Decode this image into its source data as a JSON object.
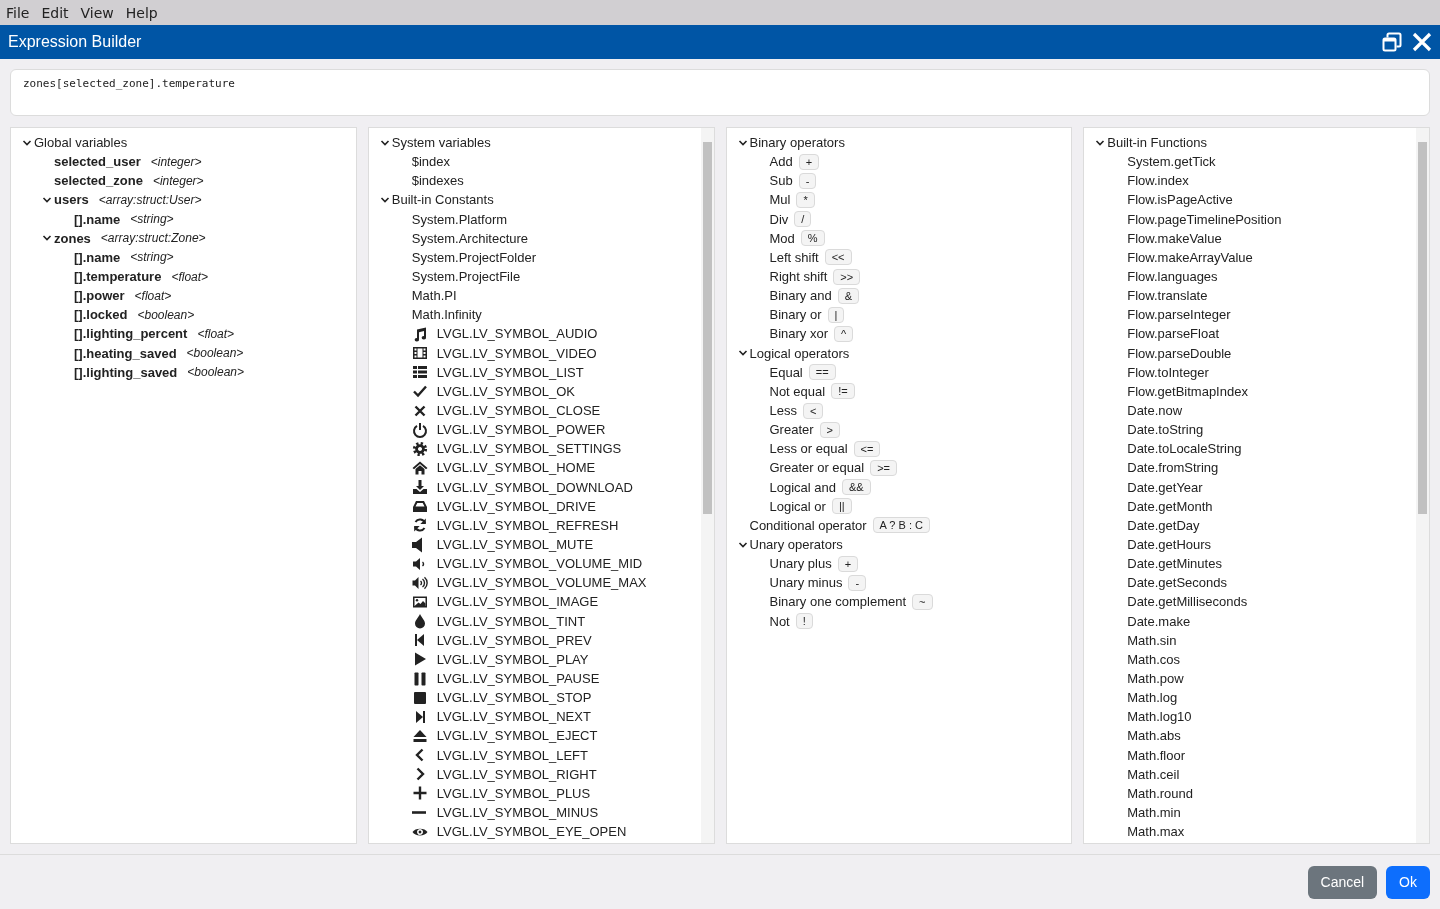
{
  "menu": [
    "File",
    "Edit",
    "View",
    "Help"
  ],
  "window": {
    "title": "Expression Builder"
  },
  "expression": {
    "value": "zones[selected_zone].temperature"
  },
  "panels": [
    {
      "kind": "variables",
      "scrollbar": false,
      "tree": [
        {
          "label": "Global variables",
          "expanded": true,
          "children": [
            {
              "label": "selected_user",
              "type": "<integer>"
            },
            {
              "label": "selected_zone",
              "type": "<integer>"
            },
            {
              "label": "users",
              "type": "<array:struct:User>",
              "expanded": true,
              "children": [
                {
                  "label": "[].name",
                  "type": "<string>"
                }
              ]
            },
            {
              "label": "zones",
              "type": "<array:struct:Zone>",
              "expanded": true,
              "children": [
                {
                  "label": "[].name",
                  "type": "<string>"
                },
                {
                  "label": "[].temperature",
                  "type": "<float>"
                },
                {
                  "label": "[].power",
                  "type": "<float>"
                },
                {
                  "label": "[].locked",
                  "type": "<boolean>"
                },
                {
                  "label": "[].lighting_percent",
                  "type": "<float>"
                },
                {
                  "label": "[].heating_saved",
                  "type": "<boolean>"
                },
                {
                  "label": "[].lighting_saved",
                  "type": "<boolean>"
                }
              ]
            }
          ]
        }
      ]
    },
    {
      "kind": "constants",
      "scrollbar": true,
      "tree": [
        {
          "label": "System variables",
          "expanded": true,
          "children": [
            {
              "label": "$index",
              "kind": "plain"
            },
            {
              "label": "$indexes",
              "kind": "plain"
            }
          ]
        },
        {
          "label": "Built-in Constants",
          "expanded": true,
          "children": [
            {
              "label": "System.Platform",
              "kind": "plain"
            },
            {
              "label": "System.Architecture",
              "kind": "plain"
            },
            {
              "label": "System.ProjectFolder",
              "kind": "plain"
            },
            {
              "label": "System.ProjectFile",
              "kind": "plain"
            },
            {
              "label": "Math.PI",
              "kind": "plain"
            },
            {
              "label": "Math.Infinity",
              "kind": "plain"
            },
            {
              "label": "LVGL.LV_SYMBOL_AUDIO",
              "kind": "audio"
            },
            {
              "label": "LVGL.LV_SYMBOL_VIDEO",
              "kind": "video"
            },
            {
              "label": "LVGL.LV_SYMBOL_LIST",
              "kind": "list"
            },
            {
              "label": "LVGL.LV_SYMBOL_OK",
              "kind": "ok"
            },
            {
              "label": "LVGL.LV_SYMBOL_CLOSE",
              "kind": "close"
            },
            {
              "label": "LVGL.LV_SYMBOL_POWER",
              "kind": "power"
            },
            {
              "label": "LVGL.LV_SYMBOL_SETTINGS",
              "kind": "settings"
            },
            {
              "label": "LVGL.LV_SYMBOL_HOME",
              "kind": "home"
            },
            {
              "label": "LVGL.LV_SYMBOL_DOWNLOAD",
              "kind": "download"
            },
            {
              "label": "LVGL.LV_SYMBOL_DRIVE",
              "kind": "drive"
            },
            {
              "label": "LVGL.LV_SYMBOL_REFRESH",
              "kind": "refresh"
            },
            {
              "label": "LVGL.LV_SYMBOL_MUTE",
              "kind": "mute"
            },
            {
              "label": "LVGL.LV_SYMBOL_VOLUME_MID",
              "kind": "volume_mid"
            },
            {
              "label": "LVGL.LV_SYMBOL_VOLUME_MAX",
              "kind": "volume_max"
            },
            {
              "label": "LVGL.LV_SYMBOL_IMAGE",
              "kind": "image"
            },
            {
              "label": "LVGL.LV_SYMBOL_TINT",
              "kind": "tint"
            },
            {
              "label": "LVGL.LV_SYMBOL_PREV",
              "kind": "prev"
            },
            {
              "label": "LVGL.LV_SYMBOL_PLAY",
              "kind": "play"
            },
            {
              "label": "LVGL.LV_SYMBOL_PAUSE",
              "kind": "pause"
            },
            {
              "label": "LVGL.LV_SYMBOL_STOP",
              "kind": "stop"
            },
            {
              "label": "LVGL.LV_SYMBOL_NEXT",
              "kind": "next"
            },
            {
              "label": "LVGL.LV_SYMBOL_EJECT",
              "kind": "eject"
            },
            {
              "label": "LVGL.LV_SYMBOL_LEFT",
              "kind": "left"
            },
            {
              "label": "LVGL.LV_SYMBOL_RIGHT",
              "kind": "right"
            },
            {
              "label": "LVGL.LV_SYMBOL_PLUS",
              "kind": "plus"
            },
            {
              "label": "LVGL.LV_SYMBOL_MINUS",
              "kind": "minus"
            },
            {
              "label": "LVGL.LV_SYMBOL_EYE_OPEN",
              "kind": "eye"
            }
          ]
        }
      ]
    },
    {
      "kind": "operators",
      "scrollbar": false,
      "tree": [
        {
          "label": "Binary operators",
          "expanded": true,
          "children": [
            {
              "label": "Add",
              "operator": "+"
            },
            {
              "label": "Sub",
              "operator": "-"
            },
            {
              "label": "Mul",
              "operator": "*"
            },
            {
              "label": "Div",
              "operator": "/"
            },
            {
              "label": "Mod",
              "operator": "%"
            },
            {
              "label": "Left shift",
              "operator": "<<"
            },
            {
              "label": "Right shift",
              "operator": ">>"
            },
            {
              "label": "Binary and",
              "operator": "&"
            },
            {
              "label": "Binary or",
              "operator": "|"
            },
            {
              "label": "Binary xor",
              "operator": "^"
            }
          ]
        },
        {
          "label": "Logical operators",
          "expanded": true,
          "children": [
            {
              "label": "Equal",
              "operator": "=="
            },
            {
              "label": "Not equal",
              "operator": "!="
            },
            {
              "label": "Less",
              "operator": "<"
            },
            {
              "label": "Greater",
              "operator": ">"
            },
            {
              "label": "Less or equal",
              "operator": "<="
            },
            {
              "label": "Greater or equal",
              "operator": ">="
            },
            {
              "label": "Logical and",
              "operator": "&&"
            },
            {
              "label": "Logical or",
              "operator": "||"
            }
          ]
        },
        {
          "label": "Conditional operator",
          "operator": "A ? B : C"
        },
        {
          "label": "Unary operators",
          "expanded": true,
          "children": [
            {
              "label": "Unary plus",
              "operator": "+"
            },
            {
              "label": "Unary minus",
              "operator": "-"
            },
            {
              "label": "Binary one complement",
              "operator": "~"
            },
            {
              "label": "Not",
              "operator": "!"
            }
          ]
        }
      ]
    },
    {
      "kind": "functions",
      "scrollbar": true,
      "tree": [
        {
          "label": "Built-in Functions",
          "expanded": true,
          "children": [
            {
              "label": "System.getTick"
            },
            {
              "label": "Flow.index"
            },
            {
              "label": "Flow.isPageActive"
            },
            {
              "label": "Flow.pageTimelinePosition"
            },
            {
              "label": "Flow.makeValue"
            },
            {
              "label": "Flow.makeArrayValue"
            },
            {
              "label": "Flow.languages"
            },
            {
              "label": "Flow.translate"
            },
            {
              "label": "Flow.parseInteger"
            },
            {
              "label": "Flow.parseFloat"
            },
            {
              "label": "Flow.parseDouble"
            },
            {
              "label": "Flow.toInteger"
            },
            {
              "label": "Flow.getBitmapIndex"
            },
            {
              "label": "Date.now"
            },
            {
              "label": "Date.toString"
            },
            {
              "label": "Date.toLocaleString"
            },
            {
              "label": "Date.fromString"
            },
            {
              "label": "Date.getYear"
            },
            {
              "label": "Date.getMonth"
            },
            {
              "label": "Date.getDay"
            },
            {
              "label": "Date.getHours"
            },
            {
              "label": "Date.getMinutes"
            },
            {
              "label": "Date.getSeconds"
            },
            {
              "label": "Date.getMilliseconds"
            },
            {
              "label": "Date.make"
            },
            {
              "label": "Math.sin"
            },
            {
              "label": "Math.cos"
            },
            {
              "label": "Math.pow"
            },
            {
              "label": "Math.log"
            },
            {
              "label": "Math.log10"
            },
            {
              "label": "Math.abs"
            },
            {
              "label": "Math.floor"
            },
            {
              "label": "Math.ceil"
            },
            {
              "label": "Math.round"
            },
            {
              "label": "Math.min"
            },
            {
              "label": "Math.max"
            }
          ]
        }
      ]
    }
  ],
  "buttons": [
    {
      "label": "Cancel",
      "kind": "secondary"
    },
    {
      "label": "Ok",
      "kind": "primary"
    }
  ]
}
